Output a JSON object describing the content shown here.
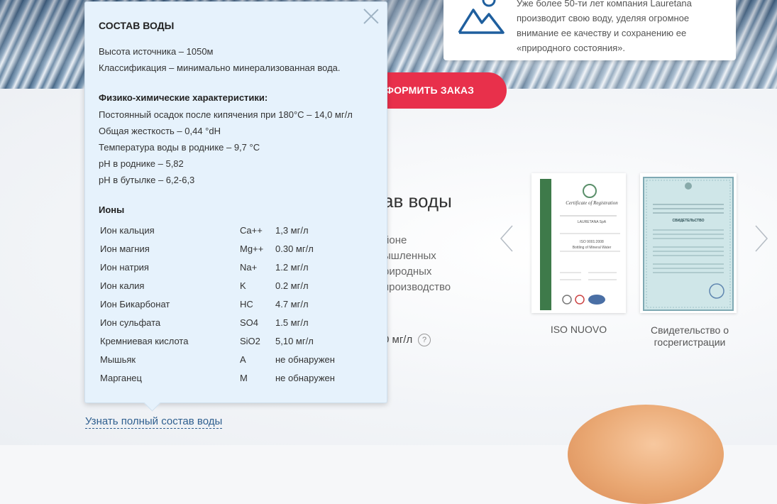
{
  "info_card": {
    "text_lines": [
      "Уже более 50-ти лет компания Lauretana",
      "производит свою воду, уделяя огромное",
      "внимание ее качеству и сохранению ее",
      "«природного состояния»."
    ]
  },
  "order_button": {
    "label": "ФОРМИТЬ ЗАКАЗ"
  },
  "background_section": {
    "title": "ав воды",
    "text_lines": [
      "йоне",
      "ышленных",
      "риродных",
      "производство"
    ],
    "mineral_value": "0 мг/л",
    "help": "?"
  },
  "certificates": [
    {
      "label": "ISO NUOVO",
      "doc_title": "Certificate of Registration",
      "company": "LAURETANA SpA",
      "standard": "ISO 9001:2008",
      "scope": "Bottling of Mineral Water"
    },
    {
      "label": "Свидетельство о госрегистрации",
      "doc_title": "СВИДЕТЕЛЬСТВО"
    }
  ],
  "popup": {
    "title": "СОСТАВ ВОДЫ",
    "source_height": "Высота источника – 1050м",
    "classification": "Классификация – минимально минерализованная вода.",
    "physchem_heading": "Физико-химические характеристики:",
    "physchem": [
      "Постоянный осадок после кипячения при 180°С – 14,0 мг/л",
      "Общая жесткость – 0,44 °dH",
      "Температура воды в роднике – 9,7 °С",
      "pH в роднике – 5,82",
      "pH в бутылке – 6,2-6,3"
    ],
    "ions_heading": "Ионы",
    "ions": [
      {
        "name": "Ион кальция",
        "symbol": "Ca++",
        "value": "1,3 мг/л"
      },
      {
        "name": "Ион магния",
        "symbol": "Mg++",
        "value": "0.30 мг/л"
      },
      {
        "name": "Ион натрия",
        "symbol": "Na+",
        "value": "1.2 мг/л"
      },
      {
        "name": "Ион калия",
        "symbol": "K",
        "value": "0.2 мг/л"
      },
      {
        "name": "Ион Бикарбонат",
        "symbol": "HC",
        "value": "4.7 мг/л"
      },
      {
        "name": "Ион сульфата",
        "symbol": "SO4",
        "value": "1.5 мг/л"
      },
      {
        "name": "Кремниевая кислота",
        "symbol": "SiO2",
        "value": "5,10 мг/л"
      },
      {
        "name": "Мышьяк",
        "symbol": "A",
        "value": "не обнаружен"
      },
      {
        "name": "Марганец",
        "symbol": "M",
        "value": "не обнаружен"
      }
    ]
  },
  "composition_link": "Узнать полный состав воды",
  "colors": {
    "accent": "#e8304b",
    "popup_bg": "#e6f2fc",
    "link": "#2f5f8f",
    "icon_blue": "#1f5f9e"
  }
}
